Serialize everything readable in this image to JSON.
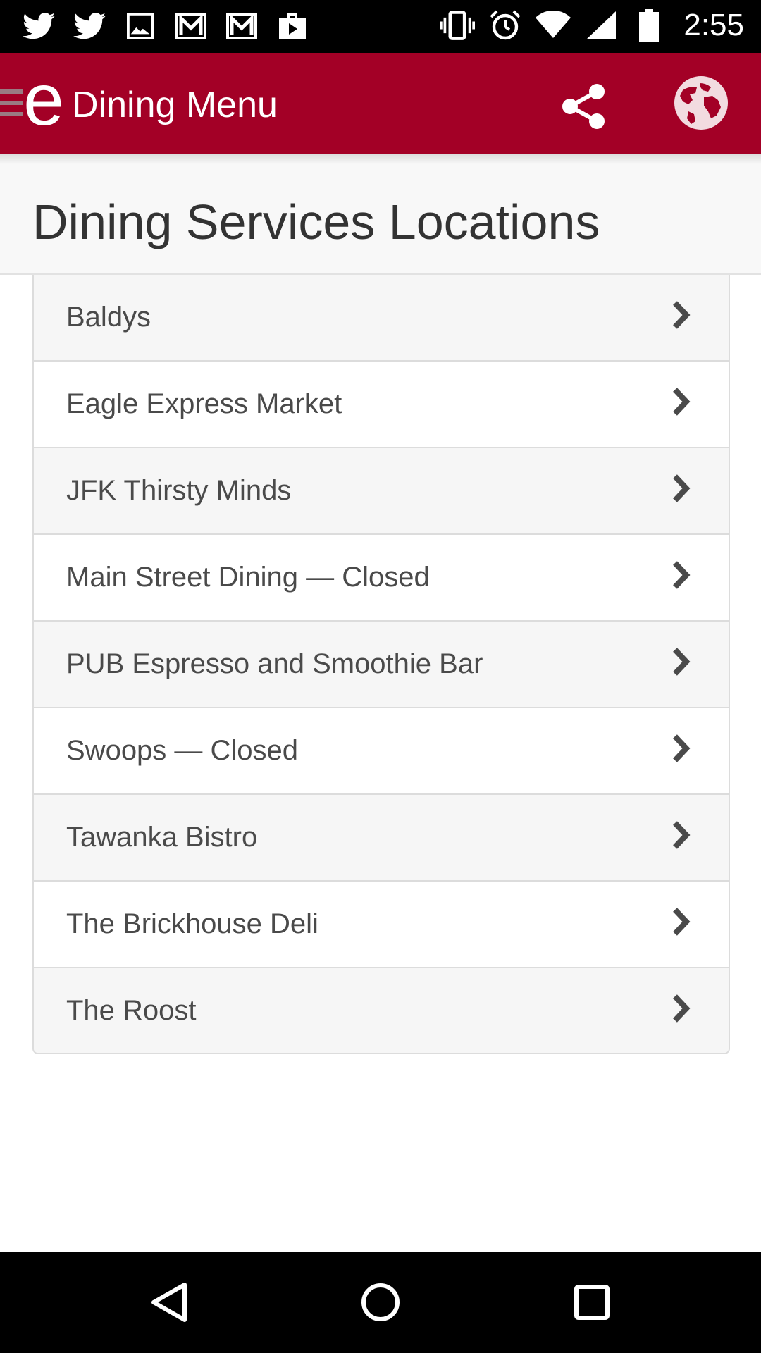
{
  "status_bar": {
    "time": "2:55",
    "left_icons": [
      "twitter-icon",
      "twitter-icon",
      "image-icon",
      "gmail-icon",
      "gmail-icon",
      "briefcase-play-icon"
    ],
    "right_icons": [
      "vibrate-icon",
      "alarm-icon",
      "wifi-icon",
      "cell-signal-icon",
      "battery-icon"
    ]
  },
  "app_bar": {
    "title": "Dining Menu",
    "background_color": "#a30026"
  },
  "page": {
    "title": "Dining Services Locations"
  },
  "locations": [
    "Baldys",
    "Eagle Express Market",
    "JFK Thirsty Minds",
    "Main Street Dining — Closed",
    "PUB Espresso and Smoothie Bar",
    "Swoops — Closed",
    "Tawanka Bistro",
    "The Brickhouse Deli",
    "The Roost"
  ],
  "nav": {
    "buttons": [
      "back-icon",
      "home-icon",
      "recents-icon"
    ]
  }
}
